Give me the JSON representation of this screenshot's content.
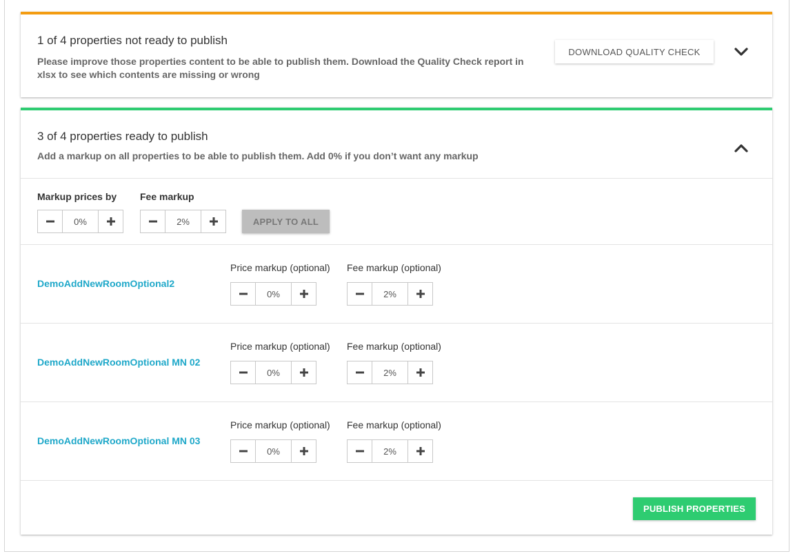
{
  "colors": {
    "warning_accent": "#f39c12",
    "success_accent": "#2ecc71",
    "link": "#1fa8c9",
    "publish_button": "#2ecc71",
    "apply_button_disabled": "#bdbdbd"
  },
  "not_ready": {
    "title": "1 of 4 properties not ready to publish",
    "description_line1": "Please improve those properties content to be able to publish them. Download the Quality Check report in",
    "description_line2": "xlsx to see which contents are missing or wrong",
    "download_button": "DOWNLOAD QUALITY CHECK",
    "toggle_icon": "chevron-down-icon"
  },
  "ready": {
    "title": "3 of 4 properties ready to publish",
    "description": "Add a markup on all properties to be able to publish them. Add 0% if you don’t want any markup",
    "toggle_icon": "chevron-up-icon",
    "global": {
      "markup_label": "Markup prices by",
      "markup_value": "0%",
      "fee_label": "Fee markup",
      "fee_value": "2%",
      "apply_button": "APPLY TO ALL"
    },
    "properties": [
      {
        "name": "DemoAddNewRoomOptional2",
        "price_label": "Price markup (optional)",
        "price_value": "0%",
        "fee_label": "Fee markup (optional)",
        "fee_value": "2%"
      },
      {
        "name": "DemoAddNewRoomOptional MN 02",
        "price_label": "Price markup (optional)",
        "price_value": "0%",
        "fee_label": "Fee markup (optional)",
        "fee_value": "2%"
      },
      {
        "name": "DemoAddNewRoomOptional MN 03",
        "price_label": "Price markup (optional)",
        "price_value": "0%",
        "fee_label": "Fee markup (optional)",
        "fee_value": "2%"
      }
    ],
    "publish_button": "PUBLISH PROPERTIES"
  }
}
